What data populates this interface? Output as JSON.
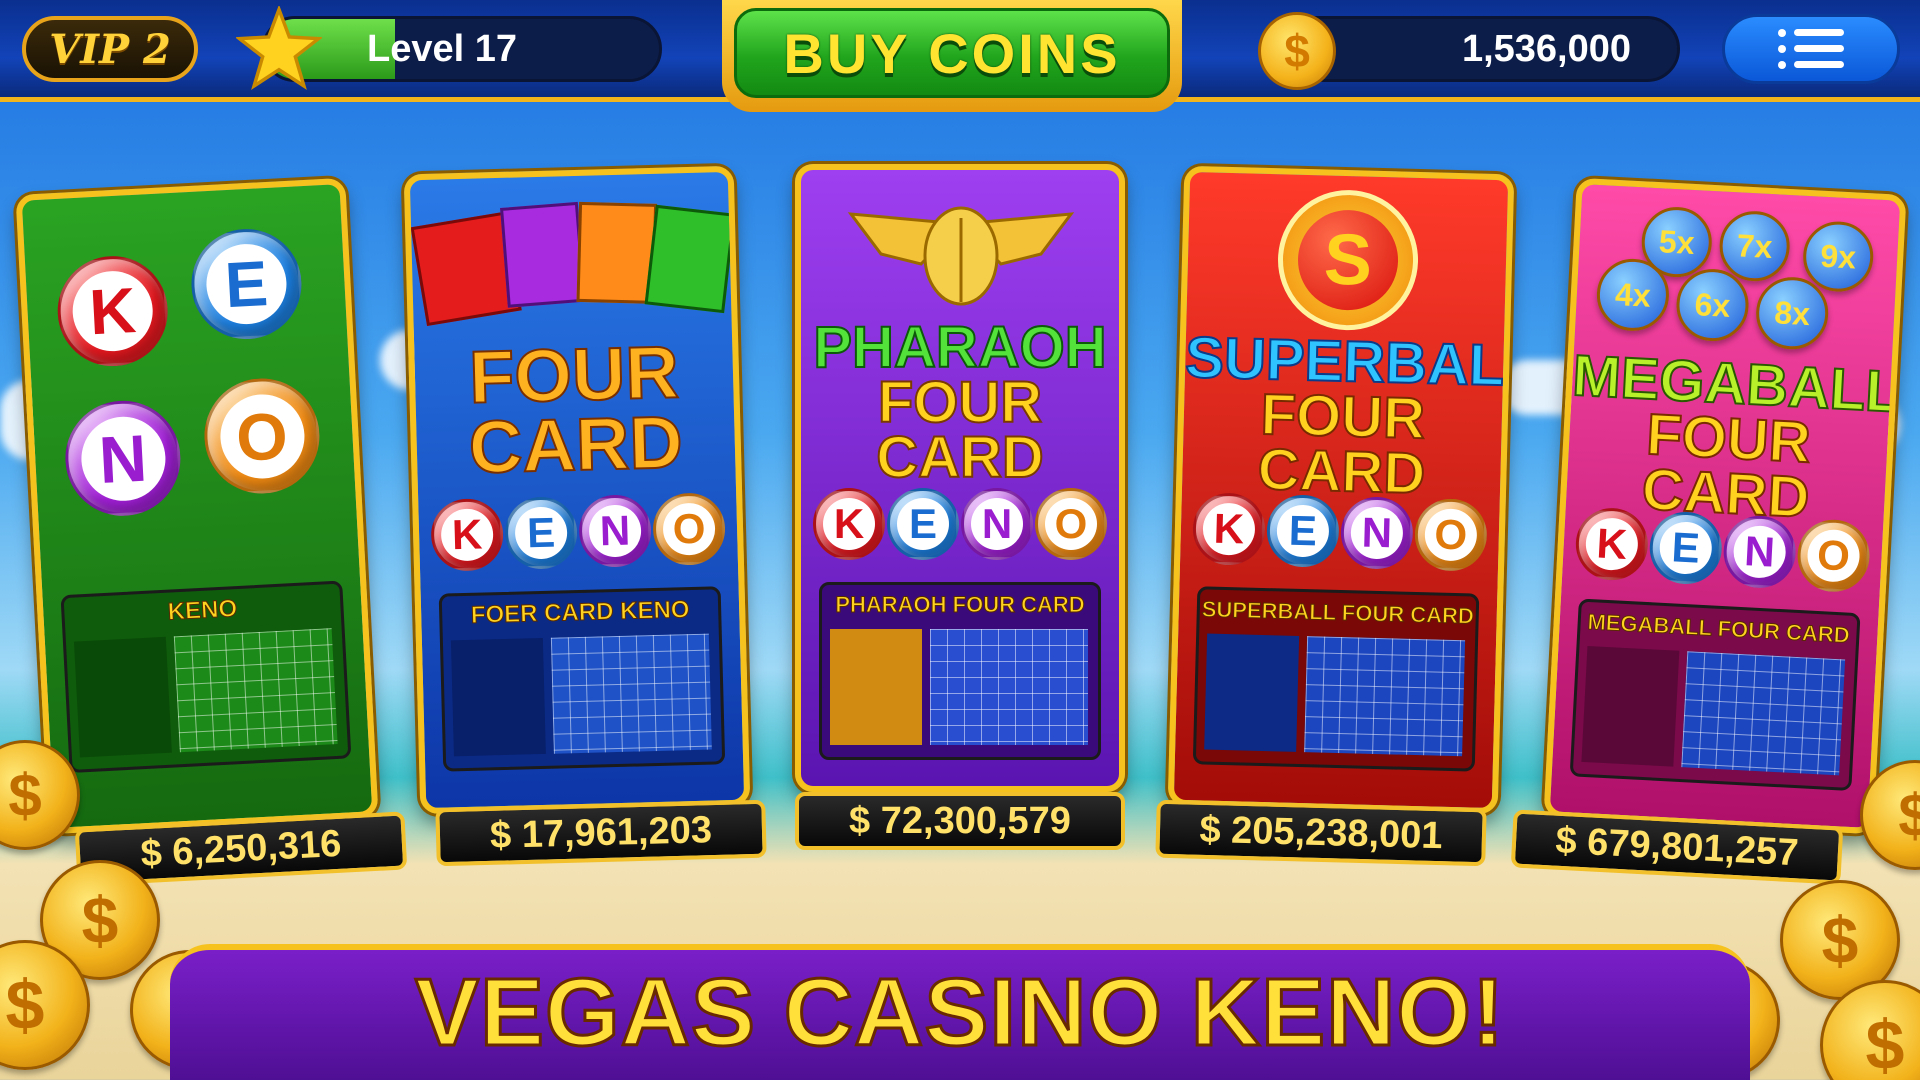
{
  "header": {
    "vip_label": "VIP 2",
    "level_label": "Level 17",
    "level_progress": 0.33,
    "buy_label": "BUY COINS",
    "coin_balance": "1,536,000",
    "coin_symbol": "$"
  },
  "games": [
    {
      "title_lines": [
        "",
        ""
      ],
      "table_title": "KENO",
      "jackpot": "$ 6,250,316",
      "theme": "#1f8a1a"
    },
    {
      "title_lines": [
        "FOUR",
        "CARD"
      ],
      "table_title": "FOER CARD KENO",
      "jackpot": "$ 17,961,203",
      "theme": "#1a4ad0"
    },
    {
      "title_lines": [
        "PHARAOH",
        "FOUR CARD"
      ],
      "table_title": "PHARAOH FOUR CARD",
      "jackpot": "$ 72,300,579",
      "theme": "#7a22d4"
    },
    {
      "title_lines": [
        "SUPERBALL",
        "FOUR CARD"
      ],
      "table_title": "SUPERBALL FOUR CARD",
      "jackpot": "$ 205,238,001",
      "theme": "#d81a10"
    },
    {
      "title_lines": [
        "MEGABALL",
        "FOUR CARD"
      ],
      "table_title": "MEGABALL FOUR CARD",
      "jackpot": "$ 679,801,257",
      "theme": "#d61a86"
    }
  ],
  "keno_letters": [
    "K",
    "E",
    "N",
    "O"
  ],
  "superball_letter": "S",
  "multipliers": [
    "5x",
    "7x",
    "9x",
    "4x",
    "6x",
    "8x"
  ],
  "banner": "VEGAS CASINO KENO!"
}
